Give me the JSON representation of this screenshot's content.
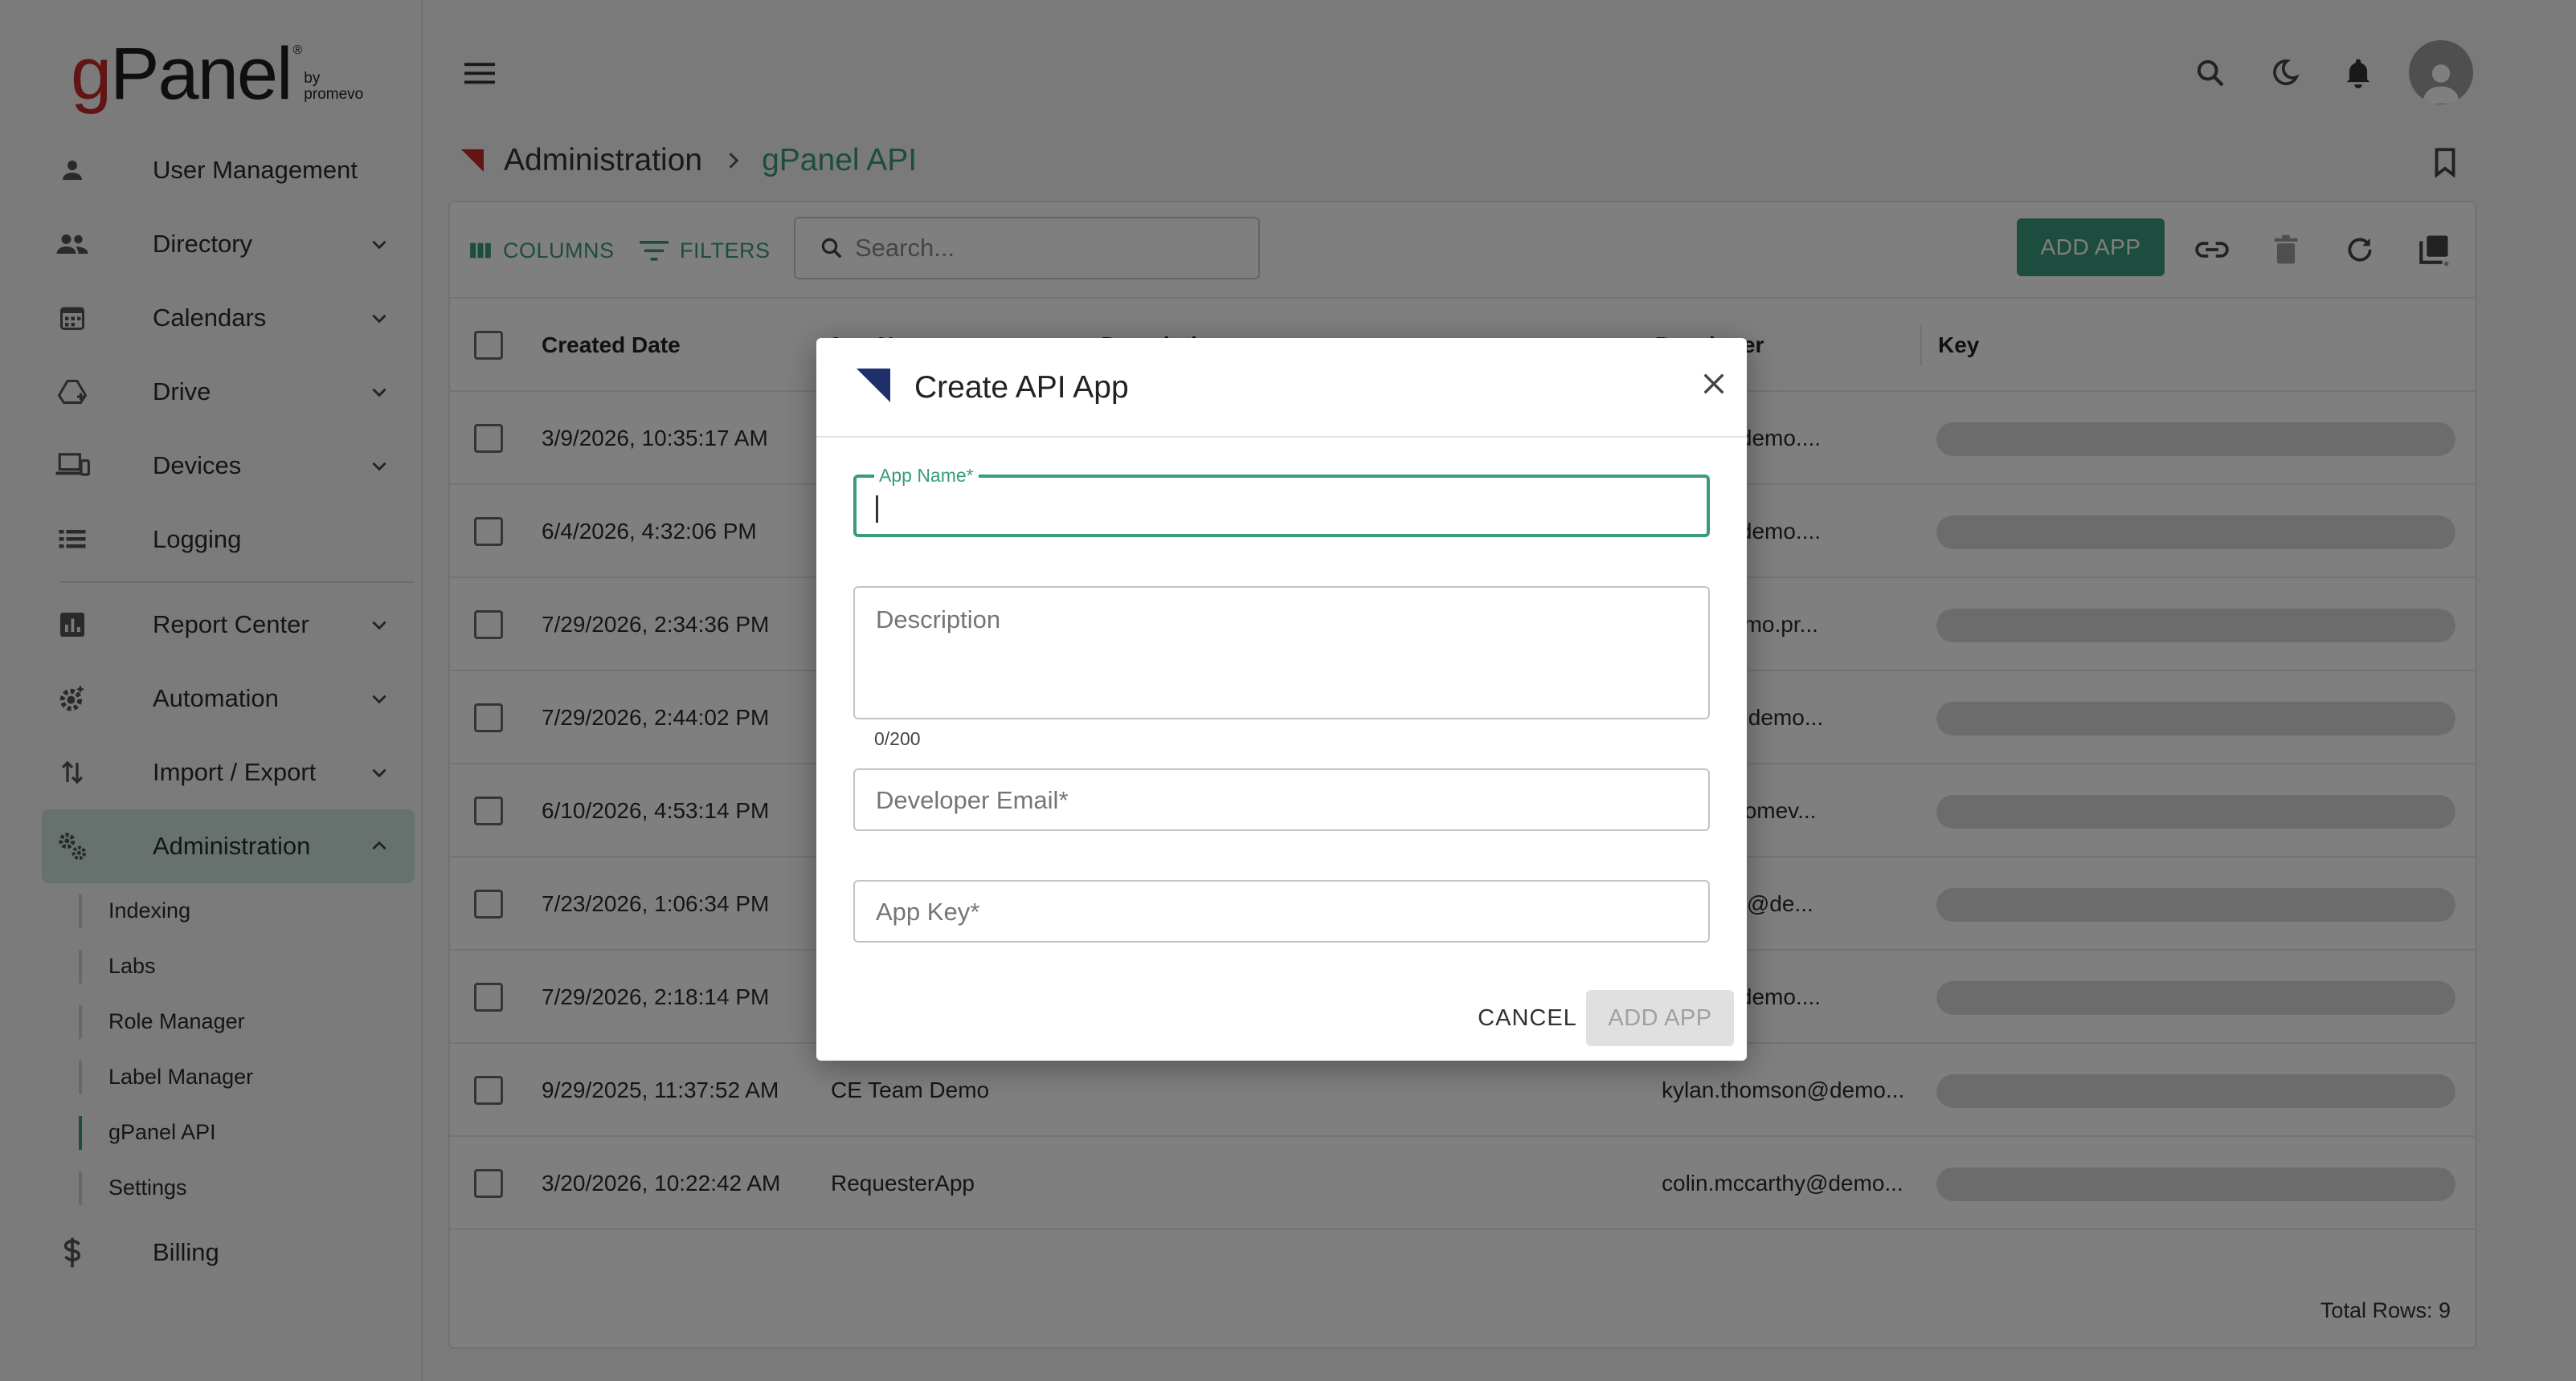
{
  "logo": {
    "g": "g",
    "panel": "Panel",
    "tm": "®",
    "by": "by",
    "brand": "promevo"
  },
  "sidebar": {
    "items": [
      {
        "label": "User Management",
        "icon": "person-icon",
        "expand": false
      },
      {
        "label": "Directory",
        "icon": "people-icon",
        "expand": true
      },
      {
        "label": "Calendars",
        "icon": "calendar-icon",
        "expand": true
      },
      {
        "label": "Drive",
        "icon": "drive-icon",
        "expand": true
      },
      {
        "label": "Devices",
        "icon": "devices-icon",
        "expand": true
      },
      {
        "label": "Logging",
        "icon": "list-icon",
        "expand": false
      },
      {
        "label": "Report Center",
        "icon": "chart-icon",
        "expand": true
      },
      {
        "label": "Automation",
        "icon": "gear-icon",
        "expand": true
      },
      {
        "label": "Import / Export",
        "icon": "import-export-icon",
        "expand": true
      },
      {
        "label": "Administration",
        "icon": "admin-gears-icon",
        "expand": true,
        "active": true
      }
    ],
    "sub_items": [
      {
        "label": "Indexing"
      },
      {
        "label": "Labs"
      },
      {
        "label": "Role Manager"
      },
      {
        "label": "Label Manager"
      },
      {
        "label": "gPanel API",
        "active": true
      },
      {
        "label": "Settings"
      }
    ],
    "billing": {
      "label": "Billing",
      "icon": "dollar-icon"
    }
  },
  "breadcrumb": {
    "parent": "Administration",
    "current": "gPanel API"
  },
  "toolbar": {
    "columns_label": "COLUMNS",
    "filters_label": "FILTERS",
    "search_placeholder": "Search...",
    "add_app_label": "ADD APP"
  },
  "grid": {
    "columns": [
      "Created Date",
      "App Name",
      "Description",
      "Developer",
      "Key"
    ],
    "rows": [
      {
        "created": "3/9/2026, 10:35:17 AM",
        "app": "",
        "developer": "omas@demo...."
      },
      {
        "created": "6/4/2026, 4:32:06 PM",
        "app": "",
        "developer": "omas@demo...."
      },
      {
        "created": "7/29/2026, 2:34:36 PM",
        "app": "",
        "developer": "law@demo.pr..."
      },
      {
        "created": "7/29/2026, 2:44:02 PM",
        "app": "",
        "developer": "elterre@demo..."
      },
      {
        "created": "6/10/2026, 4:53:14 PM",
        "app": "",
        "developer": "demo.promev..."
      },
      {
        "created": "7/23/2026, 1:06:34 PM",
        "app": "",
        "developer": "gulrajani@de..."
      },
      {
        "created": "7/29/2026, 2:18:14 PM",
        "app": "",
        "developer": "omas@demo...."
      },
      {
        "created": "9/29/2025, 11:37:52 AM",
        "app": "CE Team Demo",
        "developer": "kylan.thomson@demo..."
      },
      {
        "created": "3/20/2026, 10:22:42 AM",
        "app": "RequesterApp",
        "developer": "colin.mccarthy@demo..."
      }
    ],
    "total_rows": "Total Rows: 9"
  },
  "modal": {
    "title": "Create API App",
    "app_name_label": "App Name",
    "required_mark": "*",
    "description_placeholder": "Description",
    "description_counter": "0/200",
    "developer_email_label": "Developer Email",
    "app_key_label": "App Key",
    "cancel_label": "CANCEL",
    "submit_label": "ADD APP"
  },
  "colors": {
    "accent": "#3a9a7c",
    "brand_red": "#c62828",
    "modal_logo": "#1f2f6b"
  }
}
